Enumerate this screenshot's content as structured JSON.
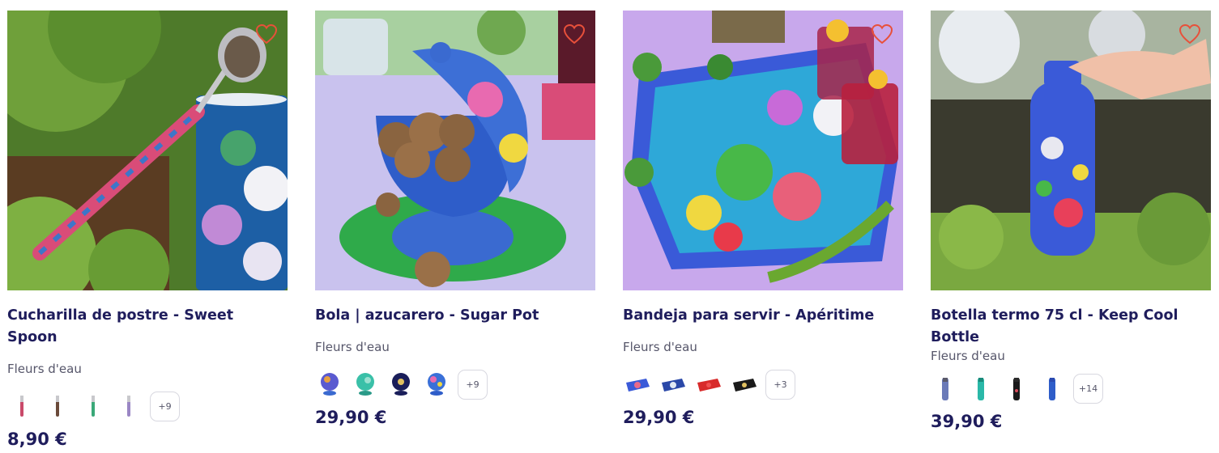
{
  "products": [
    {
      "title": "Cucharilla de postre - Sweet Spoon",
      "brand": "Fleurs d'eau",
      "more_variants": "+9",
      "price": "8,90 €",
      "image_icon": "spoon-product-photo",
      "swatch_icons": [
        "spoon-variant",
        "spoon-variant",
        "spoon-variant",
        "spoon-variant"
      ]
    },
    {
      "title": "Bola | azucarero - Sugar Pot",
      "brand": "Fleurs d'eau",
      "more_variants": "+9",
      "price": "29,90 €",
      "image_icon": "sugar-pot-product-photo",
      "swatch_icons": [
        "sugar-pot-variant",
        "sugar-pot-variant",
        "sugar-pot-variant",
        "sugar-pot-variant"
      ]
    },
    {
      "title": "Bandeja para servir - Apéritime",
      "brand": "Fleurs d'eau",
      "more_variants": "+3",
      "price": "29,90 €",
      "image_icon": "tray-product-photo",
      "swatch_icons": [
        "tray-variant",
        "tray-variant",
        "tray-variant",
        "tray-variant"
      ]
    },
    {
      "title": "Botella termo 75 cl - Keep Cool Bottle",
      "brand": "Fleurs d'eau",
      "more_variants": "+14",
      "price": "39,90 €",
      "image_icon": "bottle-product-photo",
      "swatch_icons": [
        "bottle-variant",
        "bottle-variant",
        "bottle-variant",
        "bottle-variant"
      ]
    }
  ],
  "colors": {
    "title": "#1f1d5c",
    "brand": "#56566a",
    "heart": "#e8503a",
    "border": "#d8d8e0"
  }
}
